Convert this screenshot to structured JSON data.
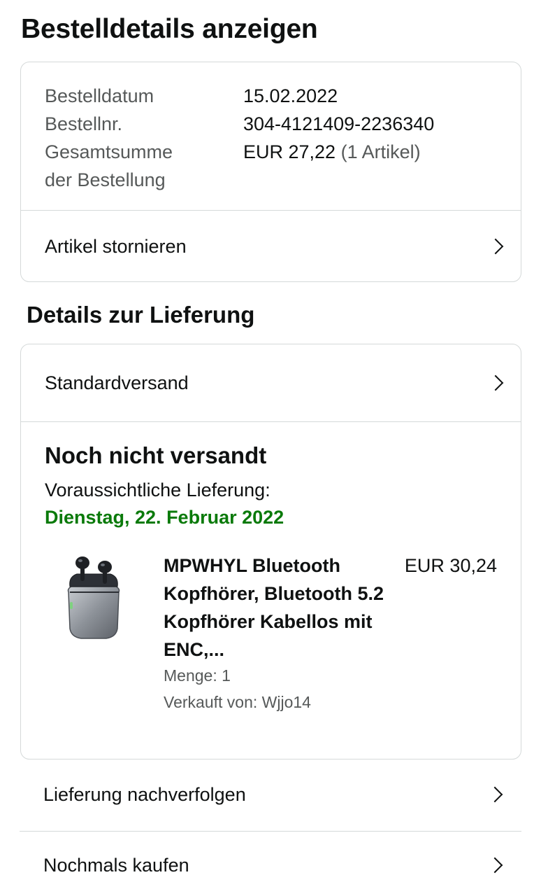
{
  "page": {
    "title": "Bestelldetails anzeigen"
  },
  "order": {
    "date_label": "Bestelldatum",
    "date_value": "15.02.2022",
    "number_label": "Bestellnr.",
    "number_value": "304-4121409-2236340",
    "total_label_line1": "Gesamtsumme",
    "total_label_line2": "der Bestellung",
    "total_value": "EUR 27,22",
    "total_items": "(1 Artikel)",
    "cancel_label": "Artikel stornieren"
  },
  "delivery": {
    "section_title": "Details zur Lieferung",
    "shipping_method": "Standardversand",
    "status": "Noch nicht versandt",
    "estimate_label": "Voraussichtliche Lieferung:",
    "estimate_date": "Dienstag, 22. Februar 2022",
    "estimate_color": "#0a7a0a"
  },
  "product": {
    "title": "MPWHYL Bluetooth Kopfhörer, Bluetooth 5.2 Kopfhörer Kabellos mit ENC,...",
    "price": "EUR 30,24",
    "quantity": "Menge: 1",
    "seller": "Verkauft von: Wjjo14",
    "image_icon": "earbuds-product-image"
  },
  "actions": {
    "track_label": "Lieferung nachverfolgen",
    "buy_again_label": "Nochmals kaufen"
  }
}
